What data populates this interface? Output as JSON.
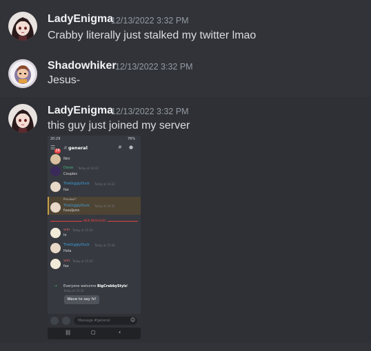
{
  "messages": [
    {
      "author": "LadyEnigma",
      "timestamp": "12/13/2022 3:32 PM",
      "content": "Crabby literally just stalked my twitter lmao"
    },
    {
      "author": "Shadowhiker",
      "timestamp": "12/13/2022 3:32 PM",
      "content": "Jesus-"
    },
    {
      "author": "LadyEnigma",
      "timestamp": "12/13/2022 3:32 PM",
      "content": "this guy just joined my server"
    }
  ],
  "attachment": {
    "status_time": "20:29",
    "battery": "76%",
    "channel": "general",
    "unread_badge": "28",
    "lines": [
      {
        "author": "",
        "time": "",
        "text": "Nini"
      },
      {
        "author": "Doxie",
        "time": "Today at 14:22",
        "text": "Couples"
      },
      {
        "author": "TheGigglyDuck",
        "time": "Today at 14:22",
        "text": "fax"
      },
      {
        "author": "TheGigglyDuck",
        "time": "Today at 14:22",
        "text": "fuuuljuns"
      },
      {
        "author": "vnn",
        "time": "Today at 15:20",
        "text": "hi"
      },
      {
        "author": "TheGigglyDuck",
        "time": "Today at 15:28",
        "text": "Hola"
      },
      {
        "author": "vnn",
        "time": "Today at 15:20",
        "text": "fax"
      }
    ],
    "reply_preview": "Preview!!",
    "new_messages_label": "NEW MESSAGES",
    "welcome_prefix": "Everyone welcome ",
    "welcome_user": "BigCrabbyStylz",
    "welcome_suffix": "!",
    "welcome_time": "Today at 15:34",
    "wave_button": "Wave to say hi!",
    "input_placeholder": "Message #general"
  },
  "colors": {
    "background": "#313338",
    "author_name": "#f2f3f5",
    "timestamp": "#949ba4",
    "message_text": "#dbdee1",
    "duck_name": "#3f9fdc",
    "doxie_name": "#43b581",
    "vnn_name": "#e06c6c"
  }
}
